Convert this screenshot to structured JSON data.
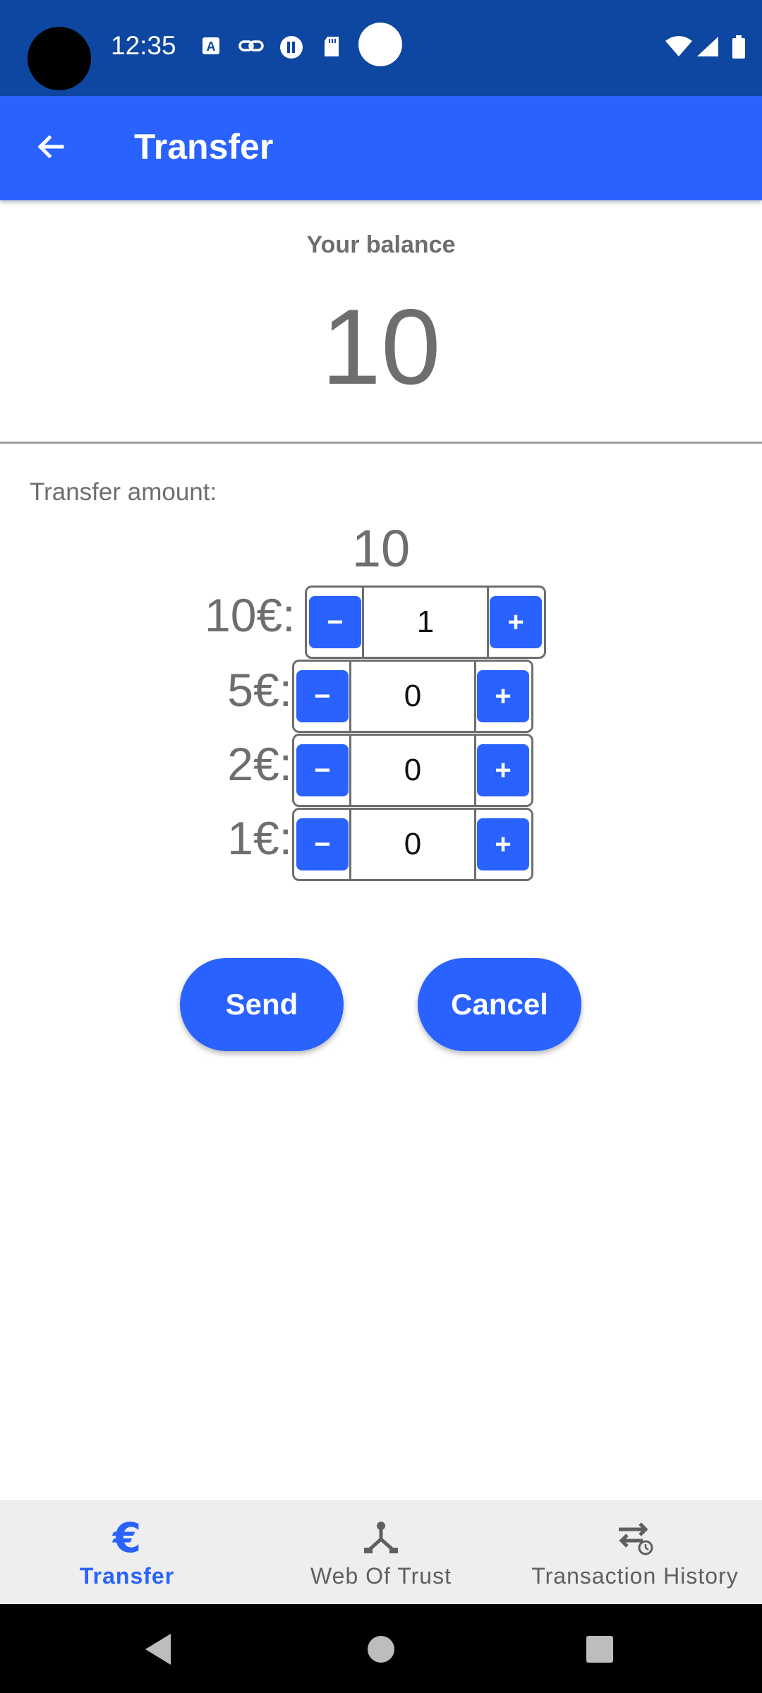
{
  "status_bar": {
    "time": "12:35",
    "icons": [
      "keyboard-a-icon",
      "link-icon",
      "pause-icon",
      "sd-card-icon",
      "wifi-icon",
      "signal-icon",
      "battery-icon"
    ]
  },
  "app_bar": {
    "title": "Transfer",
    "back_icon": "arrow-back-icon"
  },
  "balance": {
    "label": "Your balance",
    "value": "10"
  },
  "transfer": {
    "label": "Transfer amount:",
    "total": "10",
    "minus_label": "−",
    "plus_label": "+",
    "rows": [
      {
        "denomination": "10€:",
        "quantity": "1"
      },
      {
        "denomination": "5€:",
        "quantity": "0"
      },
      {
        "denomination": "2€:",
        "quantity": "0"
      },
      {
        "denomination": "1€:",
        "quantity": "0"
      }
    ]
  },
  "actions": {
    "send_label": "Send",
    "cancel_label": "Cancel"
  },
  "bottom_nav": {
    "items": [
      {
        "label": "Transfer",
        "icon": "euro-icon",
        "active": true
      },
      {
        "label": "Web Of Trust",
        "icon": "network-icon",
        "active": false
      },
      {
        "label": "Transaction History",
        "icon": "transaction-history-icon",
        "active": false
      }
    ]
  },
  "colors": {
    "status_bar": "#0d47a1",
    "primary": "#2962ff",
    "text_secondary": "#6e6e6e",
    "nav_background": "#eeeeee"
  }
}
